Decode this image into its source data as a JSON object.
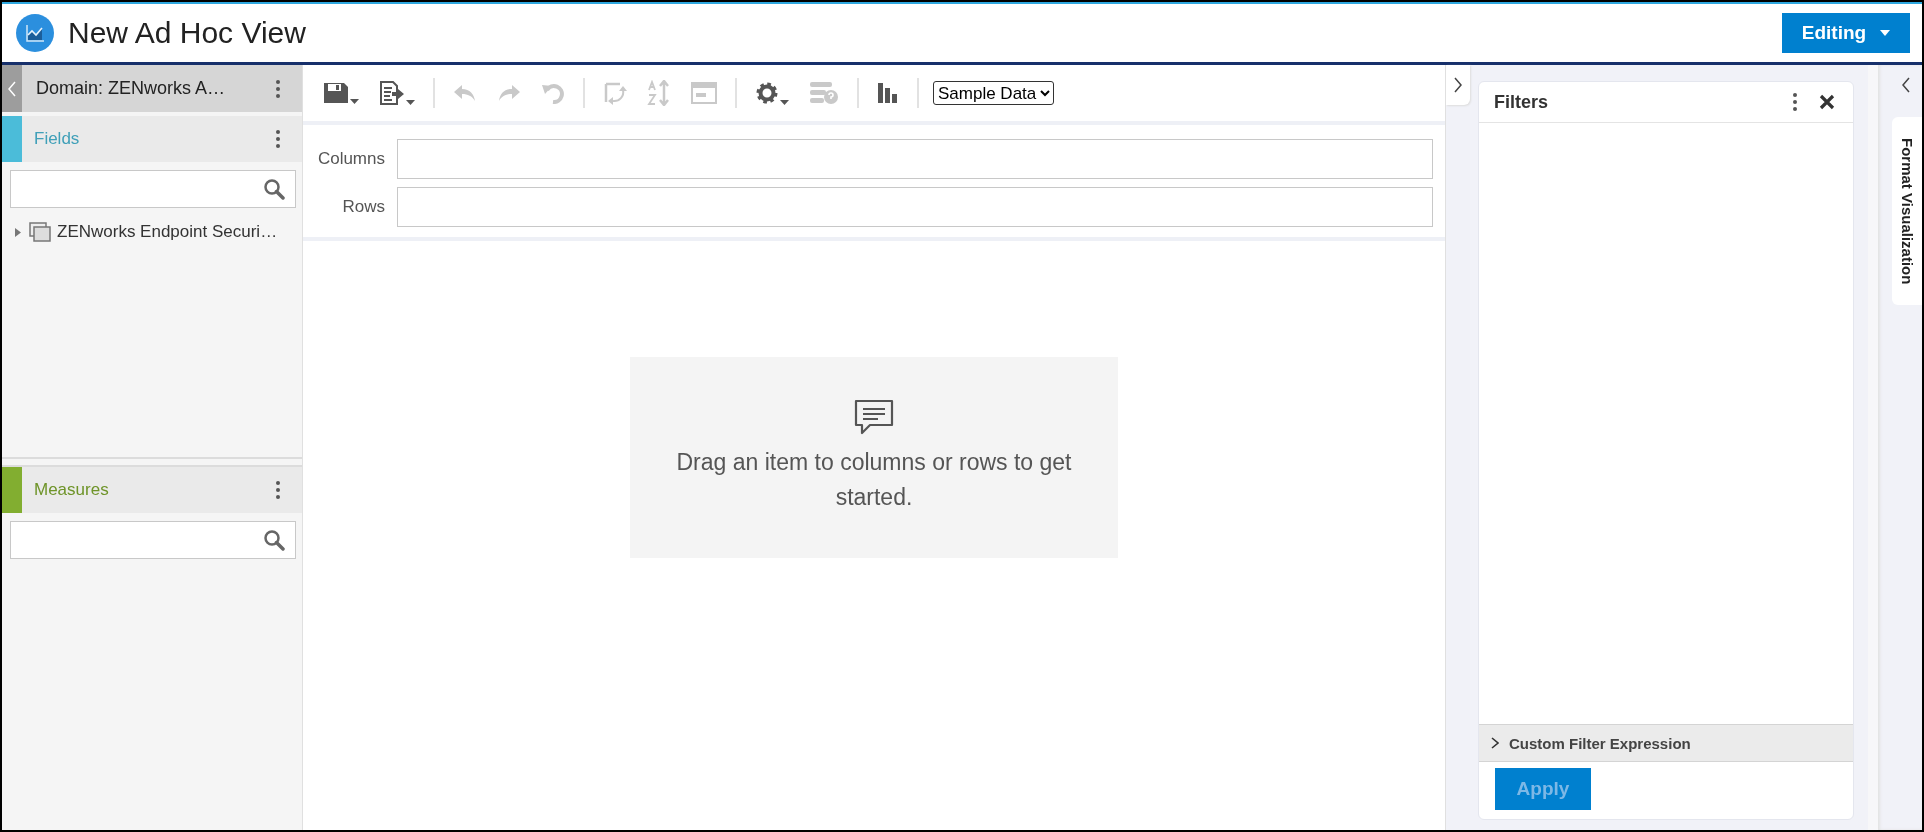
{
  "header": {
    "title": "New Ad Hoc View",
    "mode_button": {
      "label": "Editing"
    }
  },
  "left_panel": {
    "domain": {
      "label": "Domain: ZENworks A…"
    },
    "sections": [
      {
        "label": "Fields",
        "color": "#4bbcd9",
        "tree": [
          {
            "label": "ZENworks Endpoint Securi…",
            "expanded": false
          }
        ]
      },
      {
        "label": "Measures",
        "color": "#82ae30"
      }
    ]
  },
  "toolbar": {
    "groups": [
      [
        {
          "kind": "save",
          "disabled": false,
          "has_menu": true
        },
        {
          "kind": "export",
          "disabled": false,
          "has_menu": true
        }
      ],
      [
        {
          "kind": "undo",
          "disabled": true,
          "has_menu": false
        },
        {
          "kind": "redo",
          "disabled": true,
          "has_menu": false
        },
        {
          "kind": "undo-all",
          "disabled": true,
          "has_menu": false
        }
      ],
      [
        {
          "kind": "pivot",
          "disabled": true,
          "has_menu": false
        },
        {
          "kind": "sort",
          "disabled": true,
          "has_menu": false
        },
        {
          "kind": "layout",
          "disabled": true,
          "has_menu": false
        }
      ],
      [
        {
          "kind": "settings",
          "disabled": false,
          "has_menu": true
        },
        {
          "kind": "filter-help",
          "disabled": true,
          "has_menu": false
        }
      ],
      [
        {
          "kind": "chart",
          "disabled": false,
          "has_menu": false
        }
      ]
    ],
    "data_select": {
      "value": "Sample Data"
    }
  },
  "drop_zones": [
    {
      "label": "Columns"
    },
    {
      "label": "Rows"
    }
  ],
  "empty_message": "Drag an item to columns or rows to get started.",
  "filters": {
    "title": "Filters",
    "custom_expression": {
      "label": "Custom Filter Expression",
      "expanded": false
    },
    "apply_button": {
      "label": "Apply",
      "disabled": true
    }
  },
  "side_tab": {
    "label": "Format Visualization"
  }
}
